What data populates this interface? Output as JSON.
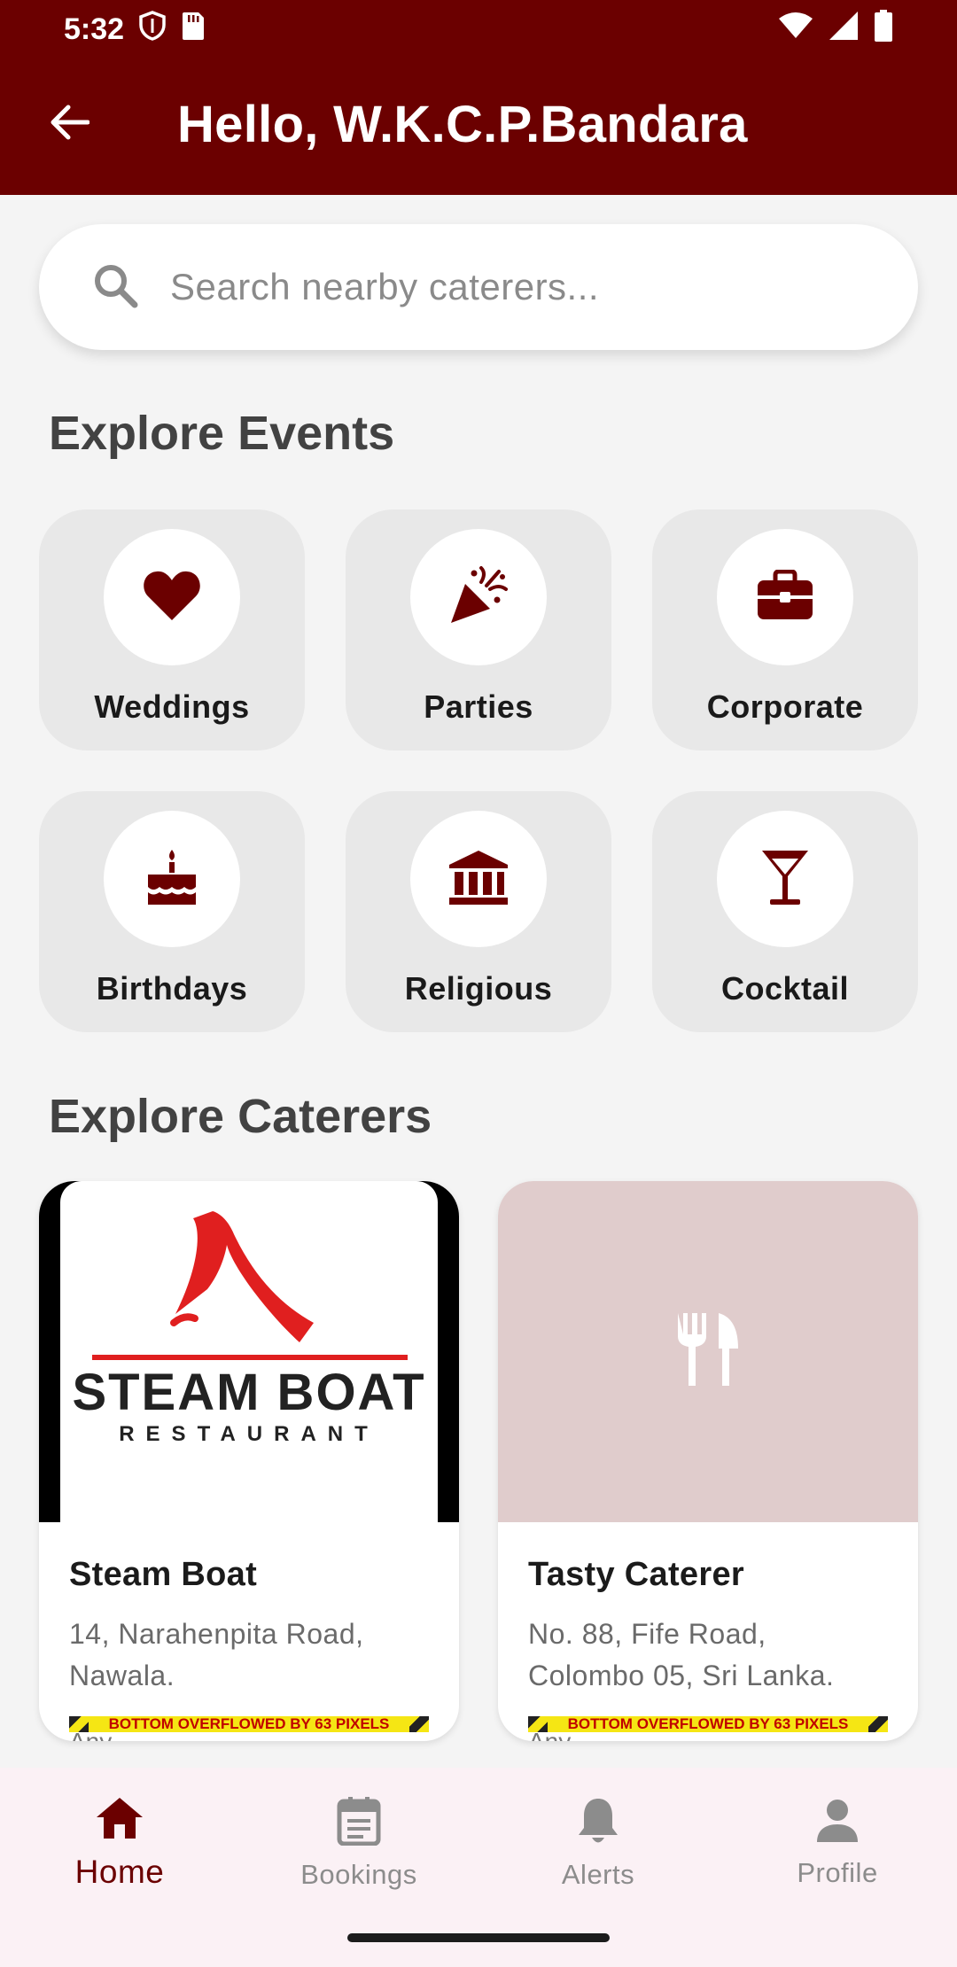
{
  "status_bar": {
    "time": "5:32"
  },
  "header": {
    "title": "Hello, W.K.C.P.Bandara"
  },
  "search": {
    "placeholder": "Search nearby caterers..."
  },
  "events": {
    "title": "Explore Events",
    "items": [
      {
        "label": "Weddings",
        "icon": "heart-icon"
      },
      {
        "label": "Parties",
        "icon": "party-popper-icon"
      },
      {
        "label": "Corporate",
        "icon": "briefcase-icon"
      },
      {
        "label": "Birthdays",
        "icon": "birthday-cake-icon"
      },
      {
        "label": "Religious",
        "icon": "temple-icon"
      },
      {
        "label": "Cocktail",
        "icon": "cocktail-glass-icon"
      }
    ]
  },
  "caterers": {
    "title": "Explore Caterers",
    "items": [
      {
        "name": "Steam Boat",
        "address": "14, Narahenpita Road, Nawala.",
        "extra": "Any",
        "logo_text": "STEAM BOAT",
        "logo_subtext": "RESTAURANT",
        "overflow_warning": "BOTTOM OVERFLOWED BY 63 PIXELS"
      },
      {
        "name": "Tasty Caterer",
        "address": "No. 88, Fife Road, Colombo 05, Sri Lanka.",
        "extra": "Any",
        "image_icon": "fork-knife-icon",
        "overflow_warning": "BOTTOM OVERFLOWED BY 63 PIXELS"
      }
    ]
  },
  "bottom_nav": {
    "items": [
      {
        "label": "Home",
        "icon": "home-icon",
        "active": true
      },
      {
        "label": "Bookings",
        "icon": "bookings-icon",
        "active": false
      },
      {
        "label": "Alerts",
        "icon": "bell-icon",
        "active": false
      },
      {
        "label": "Profile",
        "icon": "person-icon",
        "active": false
      }
    ]
  },
  "colors": {
    "primary": "#6b0000",
    "background": "#f4f4f4",
    "tile": "#e8e8e8",
    "placeholder_image": "#e0cccc",
    "nav_background": "#fbf1f5"
  }
}
